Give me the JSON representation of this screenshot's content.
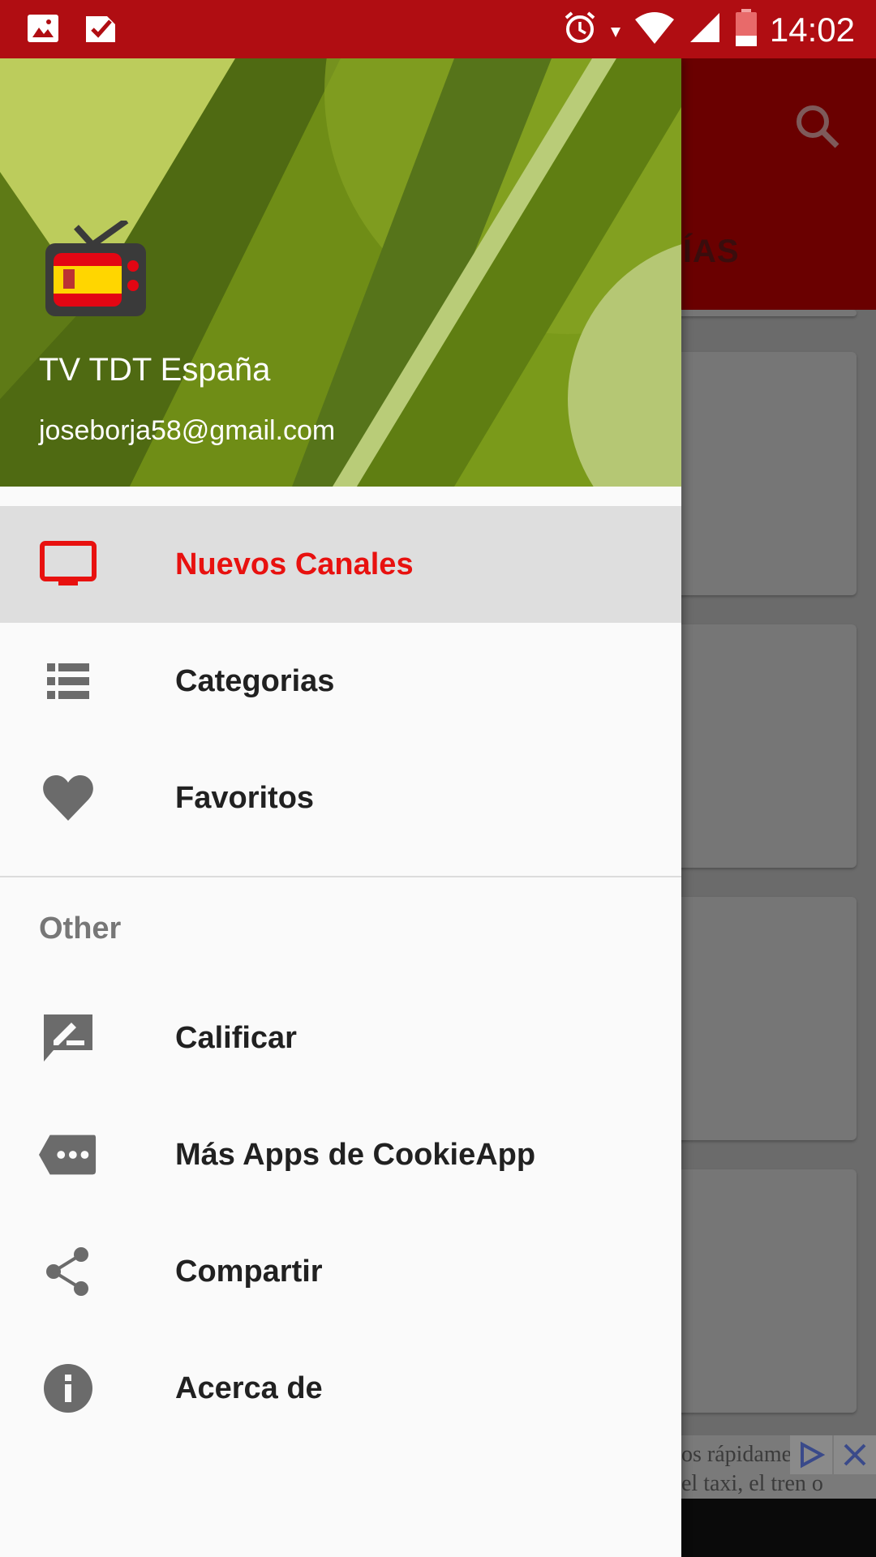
{
  "status_bar": {
    "time": "14:02",
    "icons": [
      "image-icon",
      "check-icon",
      "alarm-icon",
      "wifi-icon",
      "signal-icon",
      "battery-icon"
    ]
  },
  "background": {
    "tab_text": "RÍAS",
    "ad_text_line1": "os rápidame",
    "ad_text_line2": "el taxi, el tren o"
  },
  "drawer": {
    "app_name": "TV TDT España",
    "email": "joseborja58@gmail.com",
    "items": [
      {
        "label": "Nuevos Canales",
        "icon": "tv-icon",
        "active": true
      },
      {
        "label": "Categorias",
        "icon": "list-icon",
        "active": false
      },
      {
        "label": "Favoritos",
        "icon": "heart-icon",
        "active": false
      }
    ],
    "section_title": "Other",
    "other_items": [
      {
        "label": "Calificar",
        "icon": "rate-review-icon"
      },
      {
        "label": "Más Apps de CookieApp",
        "icon": "more-apps-icon"
      },
      {
        "label": "Compartir",
        "icon": "share-icon"
      },
      {
        "label": "Acerca de",
        "icon": "info-icon"
      }
    ]
  },
  "colors": {
    "status_bar": "#b00d12",
    "accent": "#e8110f",
    "toolbar_dim": "#6a0000",
    "icon_gray": "#6b6b6b"
  }
}
